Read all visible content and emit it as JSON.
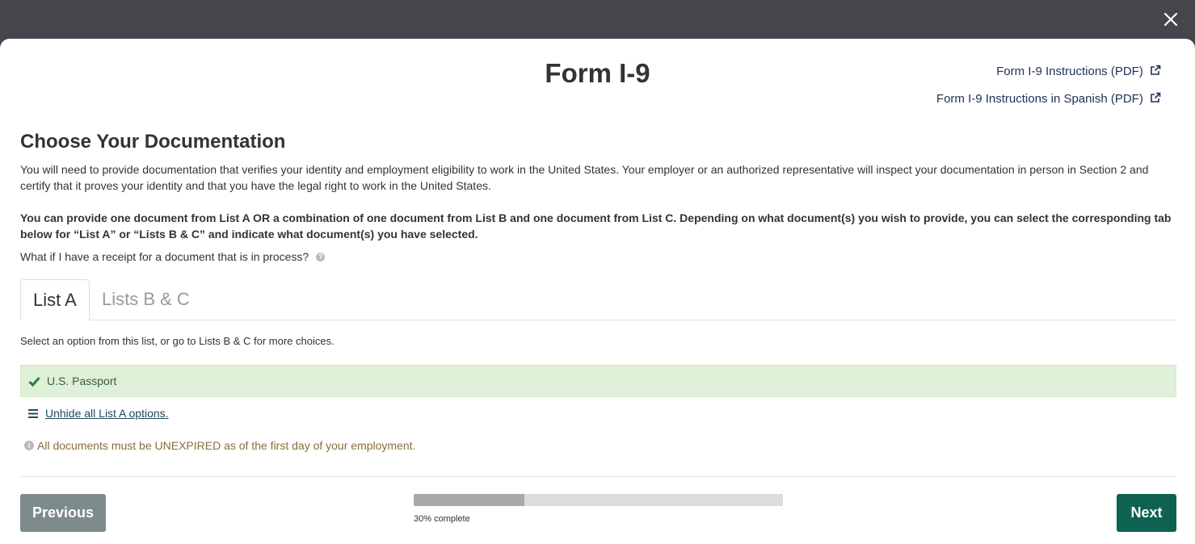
{
  "modal": {
    "title": "Form I-9",
    "links": [
      {
        "label": "Form I-9 Instructions (PDF)"
      },
      {
        "label": "Form I-9 Instructions in Spanish (PDF)"
      }
    ]
  },
  "section": {
    "heading": "Choose Your Documentation",
    "intro": "You will need to provide documentation that verifies your identity and employment eligibility to work in the United States. Your employer or an authorized representative will inspect your documentation in person in Section 2 and certify that it proves your identity and that you have the legal right to work in the United States.",
    "bold_note": "You can provide one document from List A OR a combination of one document from List B and one document from List C. Depending on what document(s) you wish to provide, you can select the corresponding tab below for “List A” or “Lists B & C” and indicate what document(s) you have selected.",
    "receipt_question": "What if I have a receipt for a document that is in process?"
  },
  "tabs": [
    {
      "label": "List A",
      "active": true
    },
    {
      "label": "Lists B & C",
      "active": false
    }
  ],
  "list_a": {
    "hint": "Select an option from this list, or go to Lists B & C for more choices.",
    "selected_option": "U.S. Passport",
    "unhide_label": "Unhide all List A options.",
    "warning": "All documents must be UNEXPIRED as of the first day of your employment."
  },
  "footer": {
    "previous_label": "Previous",
    "next_label": "Next",
    "progress_fraction": 0.3,
    "progress_label": "30% complete"
  },
  "colors": {
    "backdrop": "#45464b",
    "selected_bg": "#dff0d8",
    "next_button": "#0e6251",
    "previous_button": "#7d8b8b",
    "warning_text": "#8a6d3b"
  }
}
